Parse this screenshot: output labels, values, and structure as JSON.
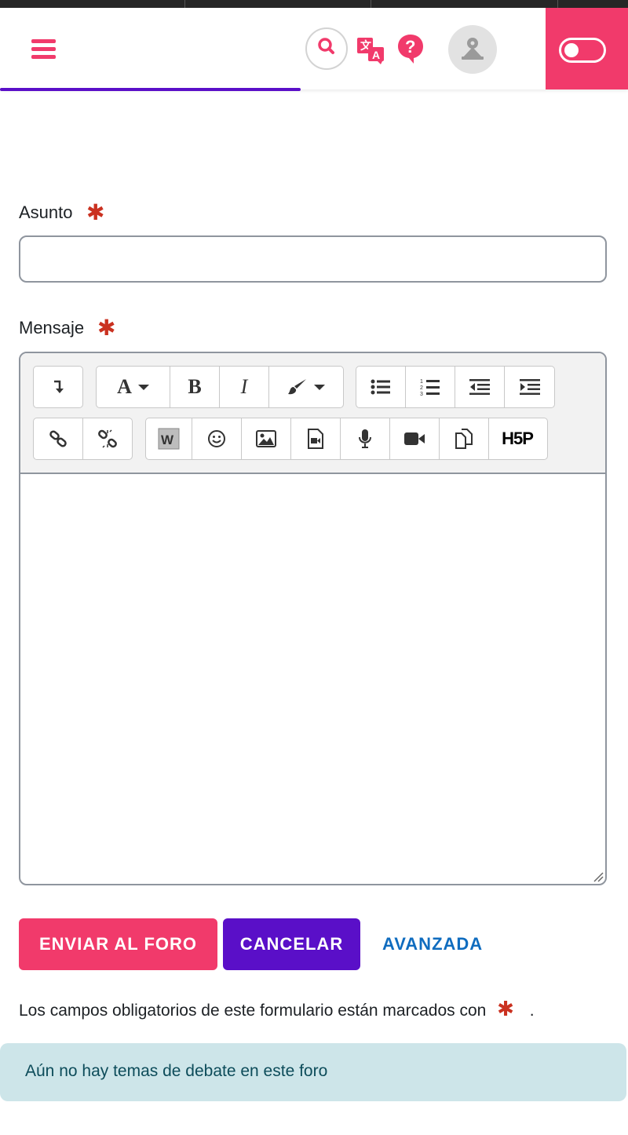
{
  "header": {
    "menu_icon": "hamburger-menu-icon",
    "search_icon": "search-icon",
    "translate_icon": "translate-icon",
    "help_icon": "help-question-icon",
    "avatar_icon": "user-avatar-icon",
    "toggle_state": "off"
  },
  "colors": {
    "brand_pink": "#f13a6b",
    "brand_purple": "#5a0fc8",
    "required_red": "#ca3120",
    "link_blue": "#0f6cbf",
    "alert_bg": "#cde5e9"
  },
  "form": {
    "subject_label": "Asunto",
    "subject_value": "",
    "message_label": "Mensaje",
    "required_marker": "✱"
  },
  "editor": {
    "toolbar_row1": [
      "collapse",
      "font",
      "bold",
      "italic",
      "style",
      "unordered-list",
      "ordered-list",
      "outdent",
      "indent"
    ],
    "toolbar_row2": [
      "link",
      "unlink",
      "word-import",
      "emoji",
      "image",
      "media",
      "record-audio",
      "record-video",
      "manage-files",
      "h5p"
    ],
    "font_label": "A",
    "bold_label": "B",
    "italic_label": "I",
    "h5p_label": "H5P"
  },
  "actions": {
    "submit_label": "ENVIAR AL FORO",
    "cancel_label": "CANCELAR",
    "advanced_label": "AVANZADA"
  },
  "note": {
    "text": "Los campos obligatorios de este formulario están marcados con",
    "end": "."
  },
  "alert": {
    "text": "Aún no hay temas de debate en este foro"
  }
}
